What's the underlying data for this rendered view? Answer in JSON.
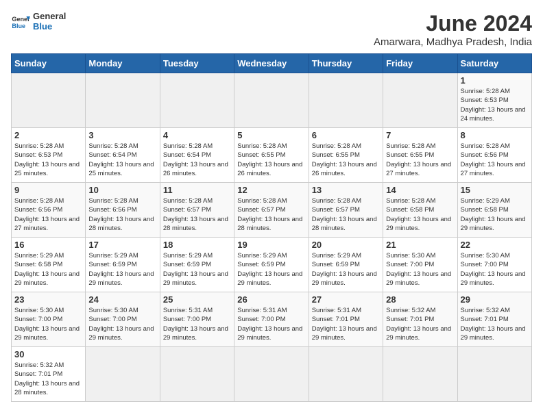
{
  "header": {
    "logo_general": "General",
    "logo_blue": "Blue",
    "main_title": "June 2024",
    "subtitle": "Amarwara, Madhya Pradesh, India"
  },
  "days_of_week": [
    "Sunday",
    "Monday",
    "Tuesday",
    "Wednesday",
    "Thursday",
    "Friday",
    "Saturday"
  ],
  "weeks": [
    [
      {
        "day": "",
        "info": ""
      },
      {
        "day": "",
        "info": ""
      },
      {
        "day": "",
        "info": ""
      },
      {
        "day": "",
        "info": ""
      },
      {
        "day": "",
        "info": ""
      },
      {
        "day": "",
        "info": ""
      },
      {
        "day": "1",
        "info": "Sunrise: 5:28 AM\nSunset: 6:53 PM\nDaylight: 13 hours and 24 minutes."
      }
    ],
    [
      {
        "day": "2",
        "info": "Sunrise: 5:28 AM\nSunset: 6:53 PM\nDaylight: 13 hours and 25 minutes."
      },
      {
        "day": "3",
        "info": "Sunrise: 5:28 AM\nSunset: 6:54 PM\nDaylight: 13 hours and 25 minutes."
      },
      {
        "day": "4",
        "info": "Sunrise: 5:28 AM\nSunset: 6:54 PM\nDaylight: 13 hours and 26 minutes."
      },
      {
        "day": "5",
        "info": "Sunrise: 5:28 AM\nSunset: 6:55 PM\nDaylight: 13 hours and 26 minutes."
      },
      {
        "day": "6",
        "info": "Sunrise: 5:28 AM\nSunset: 6:55 PM\nDaylight: 13 hours and 26 minutes."
      },
      {
        "day": "7",
        "info": "Sunrise: 5:28 AM\nSunset: 6:55 PM\nDaylight: 13 hours and 27 minutes."
      },
      {
        "day": "8",
        "info": "Sunrise: 5:28 AM\nSunset: 6:56 PM\nDaylight: 13 hours and 27 minutes."
      }
    ],
    [
      {
        "day": "9",
        "info": "Sunrise: 5:28 AM\nSunset: 6:56 PM\nDaylight: 13 hours and 27 minutes."
      },
      {
        "day": "10",
        "info": "Sunrise: 5:28 AM\nSunset: 6:56 PM\nDaylight: 13 hours and 28 minutes."
      },
      {
        "day": "11",
        "info": "Sunrise: 5:28 AM\nSunset: 6:57 PM\nDaylight: 13 hours and 28 minutes."
      },
      {
        "day": "12",
        "info": "Sunrise: 5:28 AM\nSunset: 6:57 PM\nDaylight: 13 hours and 28 minutes."
      },
      {
        "day": "13",
        "info": "Sunrise: 5:28 AM\nSunset: 6:57 PM\nDaylight: 13 hours and 28 minutes."
      },
      {
        "day": "14",
        "info": "Sunrise: 5:28 AM\nSunset: 6:58 PM\nDaylight: 13 hours and 29 minutes."
      },
      {
        "day": "15",
        "info": "Sunrise: 5:29 AM\nSunset: 6:58 PM\nDaylight: 13 hours and 29 minutes."
      }
    ],
    [
      {
        "day": "16",
        "info": "Sunrise: 5:29 AM\nSunset: 6:58 PM\nDaylight: 13 hours and 29 minutes."
      },
      {
        "day": "17",
        "info": "Sunrise: 5:29 AM\nSunset: 6:59 PM\nDaylight: 13 hours and 29 minutes."
      },
      {
        "day": "18",
        "info": "Sunrise: 5:29 AM\nSunset: 6:59 PM\nDaylight: 13 hours and 29 minutes."
      },
      {
        "day": "19",
        "info": "Sunrise: 5:29 AM\nSunset: 6:59 PM\nDaylight: 13 hours and 29 minutes."
      },
      {
        "day": "20",
        "info": "Sunrise: 5:29 AM\nSunset: 6:59 PM\nDaylight: 13 hours and 29 minutes."
      },
      {
        "day": "21",
        "info": "Sunrise: 5:30 AM\nSunset: 7:00 PM\nDaylight: 13 hours and 29 minutes."
      },
      {
        "day": "22",
        "info": "Sunrise: 5:30 AM\nSunset: 7:00 PM\nDaylight: 13 hours and 29 minutes."
      }
    ],
    [
      {
        "day": "23",
        "info": "Sunrise: 5:30 AM\nSunset: 7:00 PM\nDaylight: 13 hours and 29 minutes."
      },
      {
        "day": "24",
        "info": "Sunrise: 5:30 AM\nSunset: 7:00 PM\nDaylight: 13 hours and 29 minutes."
      },
      {
        "day": "25",
        "info": "Sunrise: 5:31 AM\nSunset: 7:00 PM\nDaylight: 13 hours and 29 minutes."
      },
      {
        "day": "26",
        "info": "Sunrise: 5:31 AM\nSunset: 7:00 PM\nDaylight: 13 hours and 29 minutes."
      },
      {
        "day": "27",
        "info": "Sunrise: 5:31 AM\nSunset: 7:01 PM\nDaylight: 13 hours and 29 minutes."
      },
      {
        "day": "28",
        "info": "Sunrise: 5:32 AM\nSunset: 7:01 PM\nDaylight: 13 hours and 29 minutes."
      },
      {
        "day": "29",
        "info": "Sunrise: 5:32 AM\nSunset: 7:01 PM\nDaylight: 13 hours and 29 minutes."
      }
    ],
    [
      {
        "day": "30",
        "info": "Sunrise: 5:32 AM\nSunset: 7:01 PM\nDaylight: 13 hours and 28 minutes."
      },
      {
        "day": "",
        "info": ""
      },
      {
        "day": "",
        "info": ""
      },
      {
        "day": "",
        "info": ""
      },
      {
        "day": "",
        "info": ""
      },
      {
        "day": "",
        "info": ""
      },
      {
        "day": "",
        "info": ""
      }
    ]
  ]
}
